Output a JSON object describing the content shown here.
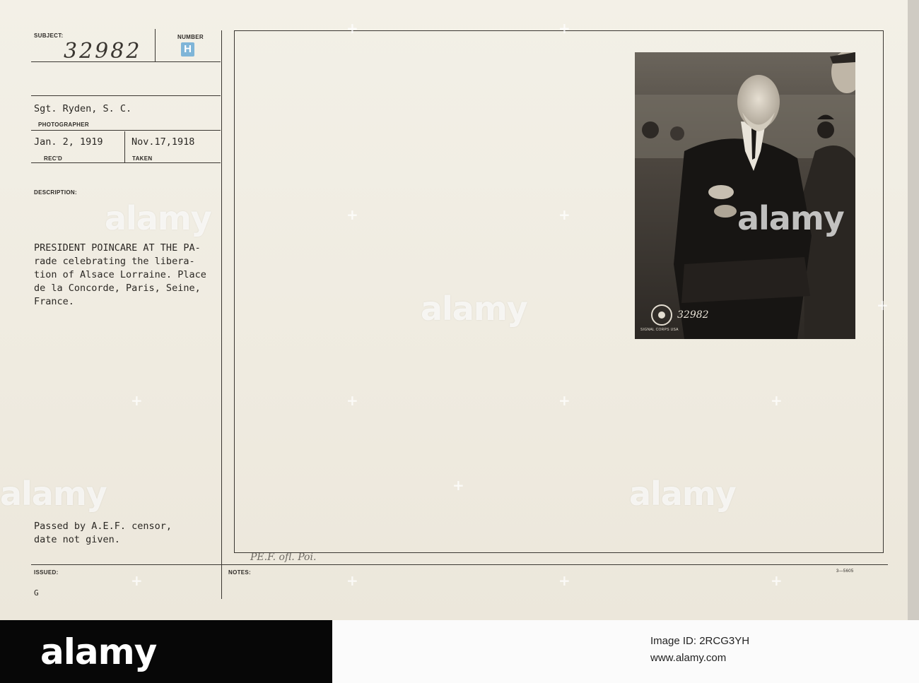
{
  "card": {
    "subject_label": "SUBJECT:",
    "subject_number": "32982",
    "number_label": "NUMBER",
    "number_stamp": "H",
    "photographer_name": "Sgt. Ryden, S. C.",
    "photographer_label": "PHOTOGRAPHER",
    "recd_date": "Jan. 2, 1919",
    "recd_label": "REC'D",
    "taken_date": "Nov.17,1918",
    "taken_label": "TAKEN",
    "description_label": "DESCRIPTION:",
    "description_text": "PRESIDENT POINCARE AT THE PA-\nrade celebrating the libera-\ntion of Alsace Lorraine. Place\nde la Concorde, Paris, Seine,\nFrance.",
    "censor_text": "Passed by A.E.F. censor,\ndate not given.",
    "issued_label": "ISSUED:",
    "issued_value": "G",
    "notes_label": "NOTES:",
    "notes_handwritten": "PE.F. ofl. Poi.",
    "form_number": "3—5605",
    "photo_stamp_number": "32982",
    "photo_stamp_text": "SIGNAL CORPS USA"
  },
  "watermark": {
    "text": "alamy"
  },
  "footer": {
    "logo_text": "alamy",
    "image_id_line": "Image ID: 2RCG3YH",
    "site_line": "www.alamy.com"
  },
  "colors": {
    "card_bg": "#f0ece2",
    "ink": "#2e2b27",
    "stamp_blue": "#7fb5d8",
    "footer_logo_bg": "#070707"
  }
}
